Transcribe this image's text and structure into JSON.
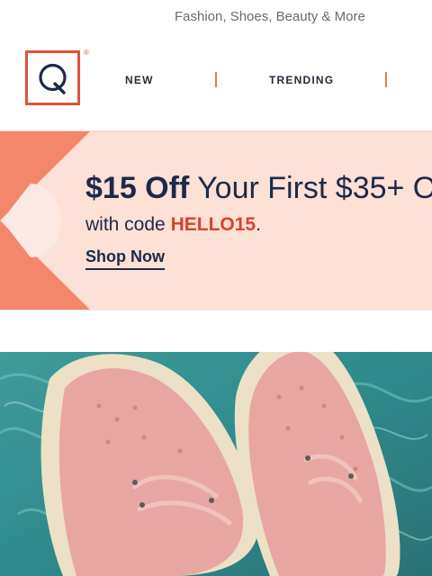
{
  "header": {
    "tagline": "Fashion, Shoes, Beauty & More",
    "logo_text": "Q",
    "logo_mark": "®",
    "nav": [
      "NEW",
      "TRENDING"
    ]
  },
  "promo": {
    "headline_bold": "$15 Off",
    "headline_rest": " Your First $35+ O",
    "sub_prefix": "with code ",
    "code": "HELLO15",
    "sub_suffix": ".",
    "cta": "Shop Now"
  },
  "hero": {
    "image": "pink-eyelet-sneakers-over-pool-water"
  },
  "colors": {
    "brand": "#e0533c",
    "navy": "#1c2a4a",
    "banner_bg": "#fde0d6",
    "accent": "#f4876b",
    "code": "#d6432c"
  }
}
